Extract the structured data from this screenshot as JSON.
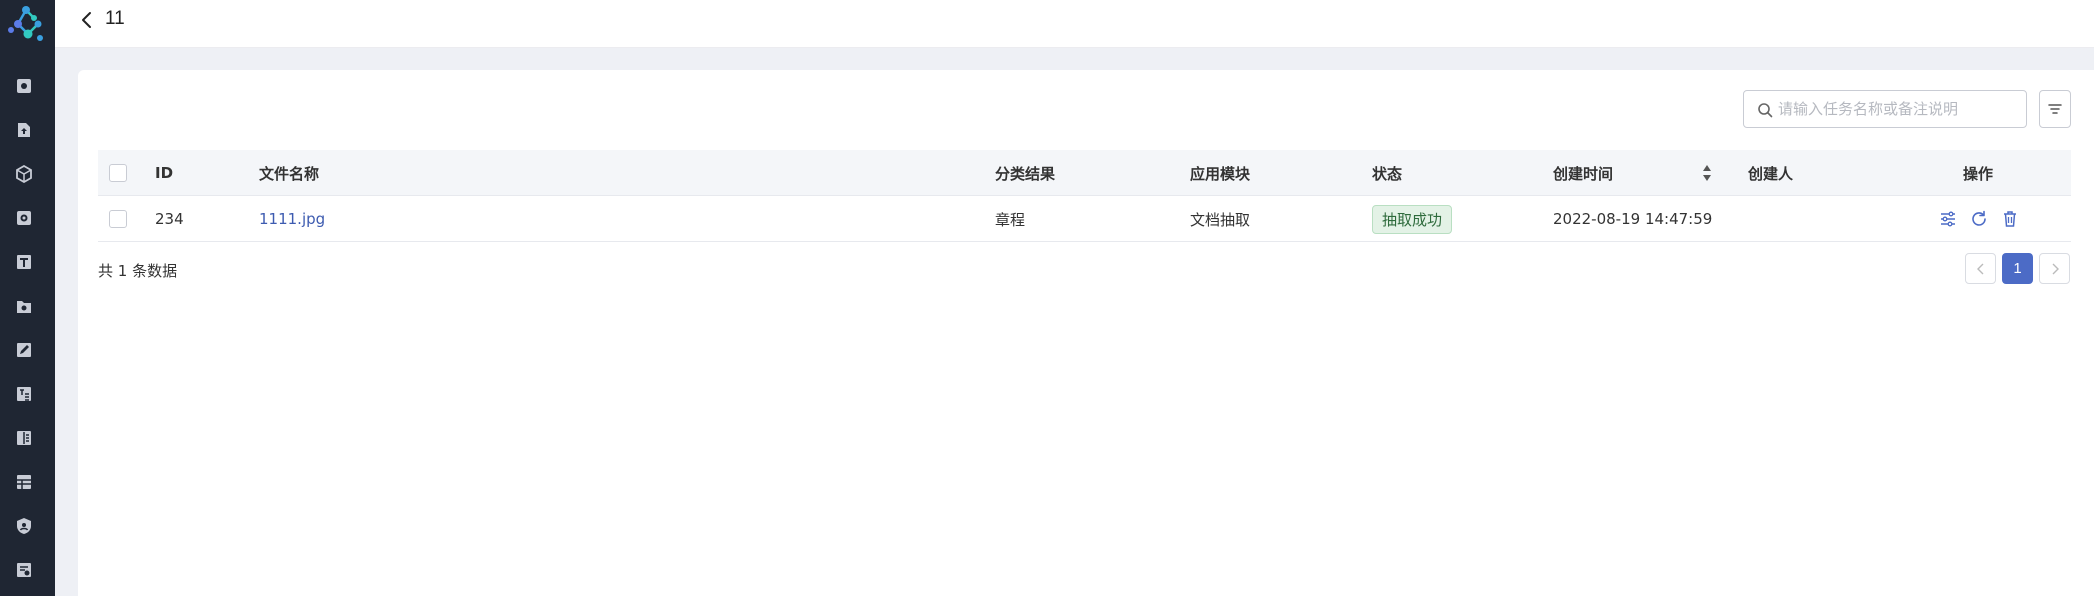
{
  "header": {
    "title": "11"
  },
  "sidebar": {
    "icons": [
      "logo-icon",
      "dashboard-icon",
      "upload-icon",
      "package-icon",
      "settings-icon",
      "text-icon",
      "folder-icon",
      "edit-icon",
      "translate-icon",
      "book-icon",
      "table-icon",
      "shield-icon",
      "report-icon"
    ]
  },
  "search": {
    "placeholder": "请输入任务名称或备注说明",
    "value": ""
  },
  "table": {
    "columns": [
      "ID",
      "文件名称",
      "分类结果",
      "应用模块",
      "状态",
      "创建时间",
      "创建人",
      "操作"
    ],
    "rows": [
      {
        "id": "234",
        "file_name": "1111.jpg",
        "classification": "章程",
        "module": "文档抽取",
        "status": "抽取成功",
        "created_at": "2022-08-19 14:47:59",
        "creator": "",
        "actions": [
          "config-icon",
          "refresh-icon",
          "delete-icon"
        ]
      }
    ]
  },
  "footer": {
    "total_text": "共 1 条数据"
  },
  "pagination": {
    "current_page": "1"
  },
  "colors": {
    "sidebar": "#1f2633",
    "accent": "#4c6bc6",
    "link": "#3d5bb0",
    "success_tag": "#e3f2e6"
  }
}
